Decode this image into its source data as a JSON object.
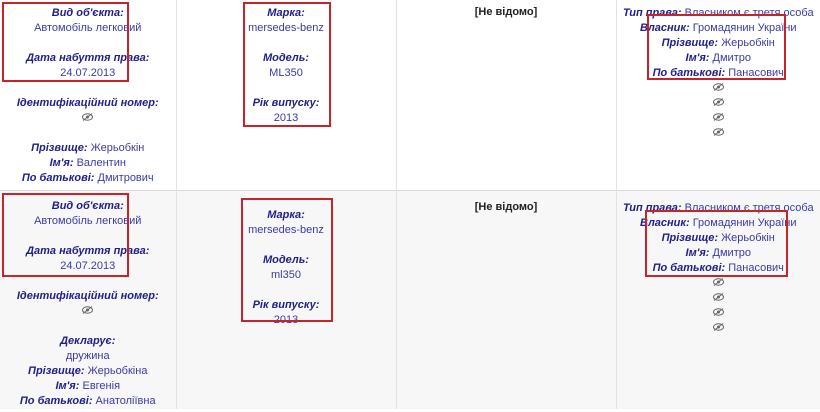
{
  "labels": {
    "object_type": "Вид об'єкта:",
    "acquired_date": "Дата набуття права:",
    "id_number": "Ідентифікаційний номер:",
    "surname": "Прізвище:",
    "name": "Ім'я:",
    "patronymic": "По батькові:",
    "brand": "Марка:",
    "model": "Модель:",
    "year": "Рік випуску:",
    "right_type": "Тип права:",
    "owner": "Власник:",
    "declarant": "Декларує:"
  },
  "rows": [
    {
      "object_type": "Автомобіль легковий",
      "acquired_date": "24.07.2013",
      "surname": "Жерьобкін",
      "name": "Валентин",
      "patronymic": "Дмитрович",
      "brand": "mersedes-benz",
      "model": "ML350",
      "year": "2013",
      "cost": "[Не відомо]",
      "right_type": "Власником є третя особа",
      "owner": "Громадянин України",
      "owner_surname": "Жерьобкін",
      "owner_name": "Дмитро",
      "owner_patronymic": "Панасович"
    },
    {
      "object_type": "Автомобіль легковий",
      "acquired_date": "24.07.2013",
      "declarant": "дружина",
      "surname": "Жерьобкіна",
      "name": "Евгенія",
      "patronymic": "Анатоліївна",
      "brand": "mersedes-benz",
      "model": "ml350",
      "year": "2013",
      "cost": "[Не відомо]",
      "right_type": "Власником є третя особа",
      "owner": "Громадянин України",
      "owner_surname": "Жерьобкін",
      "owner_name": "Дмитро",
      "owner_patronymic": "Панасович"
    }
  ],
  "colors": {
    "highlight": "#c8232a",
    "label": "#1e1e8c",
    "value": "#3a3aa8"
  },
  "icons": [
    "hidden-eye-icon"
  ]
}
